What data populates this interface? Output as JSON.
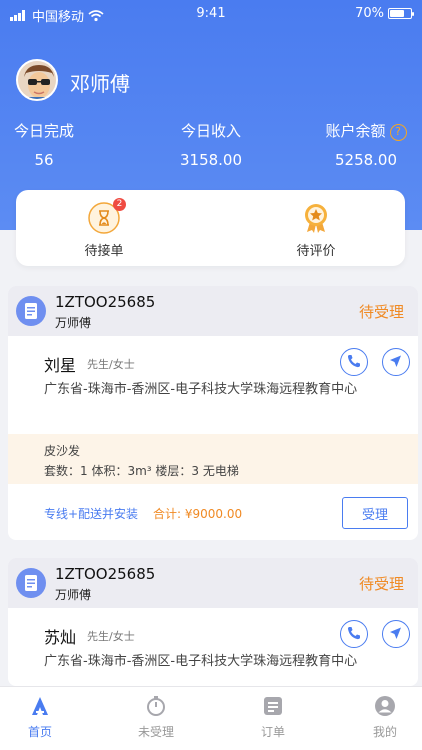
{
  "status_bar": {
    "carrier": "中国移动",
    "time": "9:41",
    "battery": "70%",
    "battery_level": 0.7
  },
  "profile": {
    "name": "邓师傅"
  },
  "stats": [
    {
      "label": "今日完成",
      "value": "56"
    },
    {
      "label": "今日收入",
      "value": "3158.00"
    },
    {
      "label": "账户余额",
      "value": "5258.00",
      "icon": "help-icon"
    }
  ],
  "help_icon_glyph": "?",
  "quick_actions": [
    {
      "label": "待接单",
      "badge": "2",
      "icon": "hourglass-icon"
    },
    {
      "label": "待评价",
      "icon": "medal-icon"
    }
  ],
  "orders": [
    {
      "order_no": "1ZTOO25685",
      "worker": "万师傅",
      "status": "待受理",
      "customer_name": "刘星",
      "customer_title": "先生/女士",
      "address": "广东省-珠海市-香洲区-电子科技大学珠海远程教育中心",
      "item": "皮沙发",
      "meta": "套数：1    体积：3m³    楼层：3 无电梯",
      "service": "专线+配送并安装",
      "total": "合计: ¥9000.00",
      "action": "受理"
    },
    {
      "order_no": "1ZTOO25685",
      "worker": "万师傅",
      "status": "待受理",
      "customer_name": "苏灿",
      "customer_title": "先生/女士",
      "address": "广东省-珠海市-香洲区-电子科技大学珠海远程教育中心"
    }
  ],
  "tabs": [
    {
      "label": "首页",
      "icon": "home-icon",
      "active": true
    },
    {
      "label": "未受理",
      "icon": "stopwatch-icon",
      "active": false
    },
    {
      "label": "订单",
      "icon": "order-icon",
      "active": false
    },
    {
      "label": "我的",
      "icon": "user-icon",
      "active": false
    }
  ],
  "colors": {
    "primary": "#4a7cf0",
    "accent": "#f08a24",
    "badge": "#ef4b42"
  }
}
